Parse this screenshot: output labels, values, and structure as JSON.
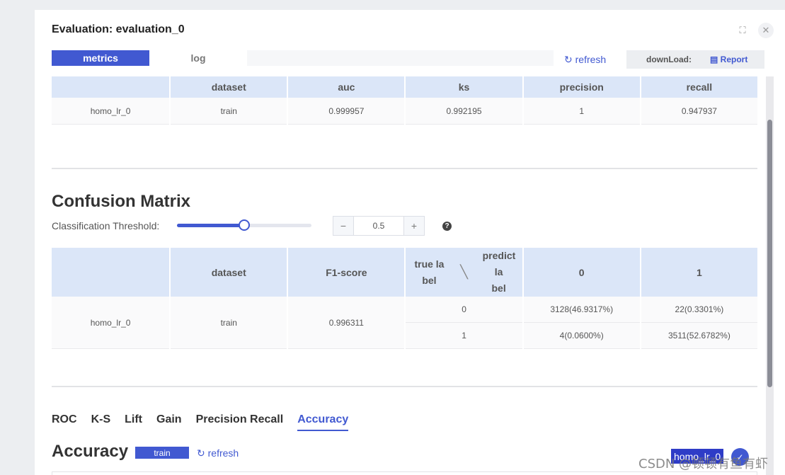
{
  "modal": {
    "title": "Evaluation: evaluation_0"
  },
  "tabs": [
    {
      "label": "metrics",
      "active": true
    },
    {
      "label": "log",
      "active": false
    }
  ],
  "toolbar": {
    "refresh_label": "refresh",
    "download_label": "downLoad:",
    "report_label": "Report"
  },
  "metrics_table": {
    "headers": [
      "",
      "dataset",
      "auc",
      "ks",
      "precision",
      "recall"
    ],
    "rows": [
      [
        "homo_lr_0",
        "train",
        "0.999957",
        "0.992195",
        "1",
        "0.947937"
      ]
    ]
  },
  "confusion": {
    "title": "Confusion Matrix",
    "threshold_label": "Classification Threshold:",
    "threshold_value": "0.5",
    "threshold_fraction": 0.5,
    "minus": "−",
    "plus": "+",
    "help": "?",
    "headers": {
      "blank": "",
      "dataset": "dataset",
      "f1": "F1-score",
      "true_label_1": "true la",
      "true_label_2": "bel",
      "slash": "╲",
      "predict_label_1": "predict la",
      "predict_label_2": "bel",
      "col0": "0",
      "col1": "1"
    },
    "row": {
      "model": "homo_lr_0",
      "dataset": "train",
      "f1": "0.996311",
      "cells": [
        {
          "label": "0",
          "pred0": "3128(46.9317%)",
          "pred1": "22(0.3301%)"
        },
        {
          "label": "1",
          "pred0": "4(0.0600%)",
          "pred1": "3511(52.6782%)"
        }
      ]
    }
  },
  "chart_tabs": [
    {
      "label": "ROC",
      "active": false
    },
    {
      "label": "K-S",
      "active": false
    },
    {
      "label": "Lift",
      "active": false
    },
    {
      "label": "Gain",
      "active": false
    },
    {
      "label": "Precision Recall",
      "active": false
    },
    {
      "label": "Accuracy",
      "active": true
    }
  ],
  "accuracy": {
    "title": "Accuracy",
    "badge": "train",
    "refresh_label": "refresh",
    "legend_label": "homo_lr_0"
  },
  "watermark": "CSDN @顿顿有鱼有虾",
  "colors": {
    "accent": "#4159d1",
    "header_bg": "#dbe6f8",
    "page_bg": "#eceef1"
  }
}
